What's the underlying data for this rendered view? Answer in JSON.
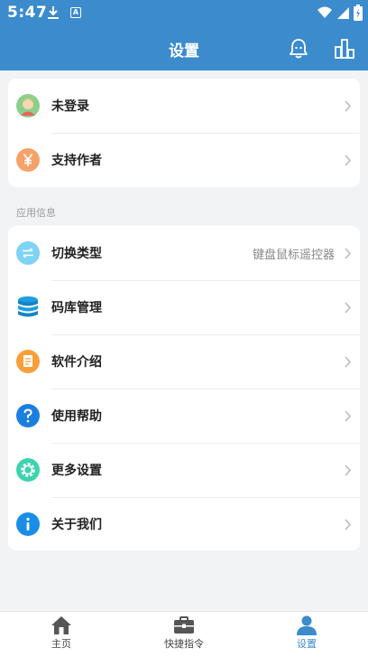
{
  "status_bar": {
    "time": "5:47",
    "a_badge": "A"
  },
  "header": {
    "title": "设置",
    "bell_icon": "bell-icon",
    "chart_icon": "bar-chart-icon"
  },
  "account": {
    "items": [
      {
        "label": "未登录",
        "icon": "avatar-icon"
      },
      {
        "label": "支持作者",
        "icon": "yuan-icon"
      }
    ]
  },
  "app_info": {
    "section_title": "应用信息",
    "items": [
      {
        "label": "切换类型",
        "value": "键盘鼠标遥控器",
        "icon": "switch-arrows-icon"
      },
      {
        "label": "码库管理",
        "icon": "database-icon"
      },
      {
        "label": "软件介绍",
        "icon": "document-icon"
      },
      {
        "label": "使用帮助",
        "icon": "help-icon"
      },
      {
        "label": "更多设置",
        "icon": "gear-icon"
      },
      {
        "label": "关于我们",
        "icon": "info-icon"
      }
    ]
  },
  "tabbar": {
    "items": [
      {
        "label": "主页",
        "icon": "home-icon"
      },
      {
        "label": "快捷指令",
        "icon": "toolbox-icon"
      },
      {
        "label": "设置",
        "icon": "person-icon",
        "active": true
      }
    ]
  },
  "colors": {
    "primary": "#3b8bcd",
    "background": "#f2f3f5",
    "card": "#ffffff"
  }
}
